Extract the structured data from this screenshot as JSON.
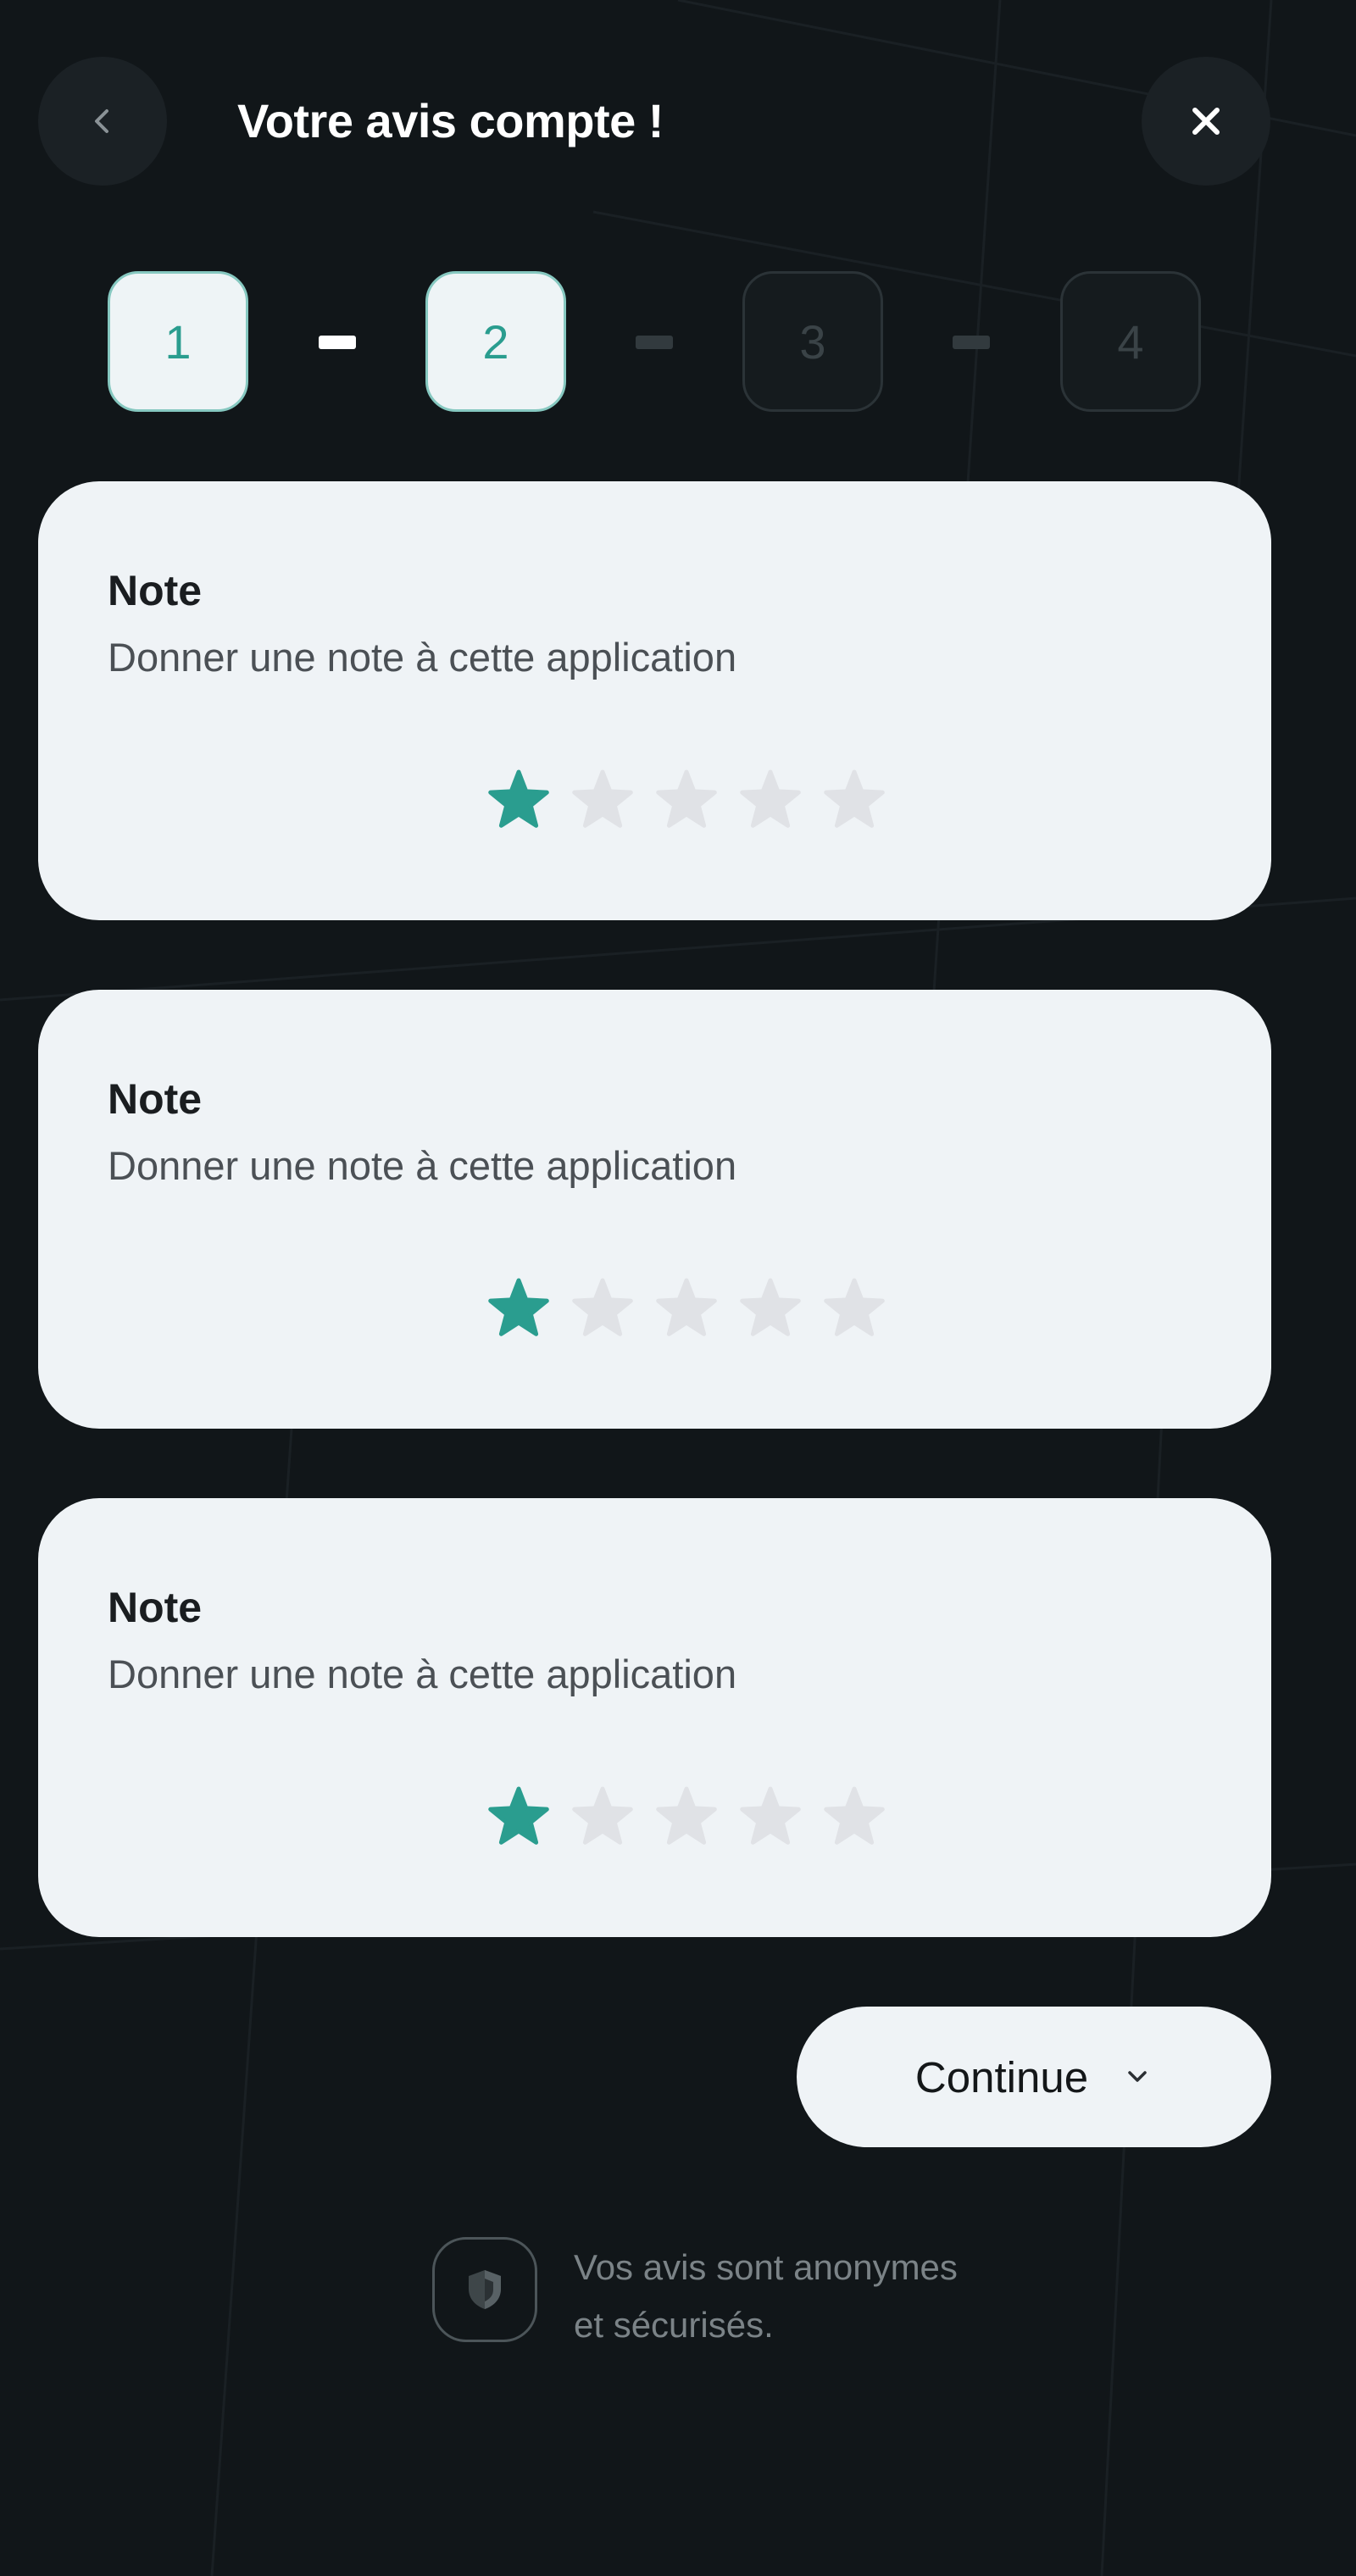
{
  "header": {
    "title": "Votre avis compte !",
    "back_icon": "chevron-left-icon",
    "close_icon": "close-icon"
  },
  "steps": [
    {
      "label": "1",
      "state": "active"
    },
    {
      "label": "2",
      "state": "active"
    },
    {
      "label": "3",
      "state": "inactive"
    },
    {
      "label": "4",
      "state": "inactive"
    }
  ],
  "cards": [
    {
      "label": "Note",
      "description": "Donner une note à cette application",
      "rating": 1,
      "max_rating": 5
    },
    {
      "label": "Note",
      "description": "Donner une note à cette application",
      "rating": 1,
      "max_rating": 5
    },
    {
      "label": "Note",
      "description": "Donner une note à cette application",
      "rating": 1,
      "max_rating": 5
    }
  ],
  "continue_button": {
    "label": "Continue",
    "icon": "chevron-down-icon"
  },
  "security_note": {
    "icon": "shield-icon",
    "line1": "Vos avis sont anonymes",
    "line2": "et sécurisés."
  },
  "colors": {
    "background": "#111619",
    "card": "#eff3f6",
    "accent": "#2a9d8f",
    "star_empty": "#e0e2e6"
  }
}
